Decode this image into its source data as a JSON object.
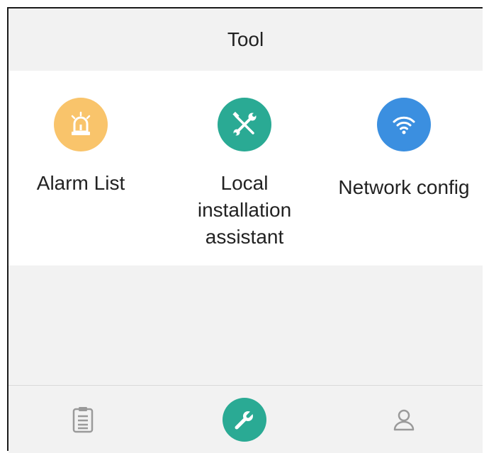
{
  "header": {
    "title": "Tool"
  },
  "tools": [
    {
      "label": "Alarm List",
      "icon": "alarm-siren-icon",
      "color": "#f9c46b"
    },
    {
      "label": "Local installation assistant",
      "icon": "tools-icon",
      "color": "#2aaa94"
    },
    {
      "label": "Network config",
      "icon": "wifi-icon",
      "color": "#3b8fe0"
    }
  ],
  "bottom_nav": [
    {
      "icon": "clipboard-list-icon",
      "active": false
    },
    {
      "icon": "wrench-icon",
      "active": true,
      "color": "#2aaa94"
    },
    {
      "icon": "user-icon",
      "active": false
    }
  ]
}
